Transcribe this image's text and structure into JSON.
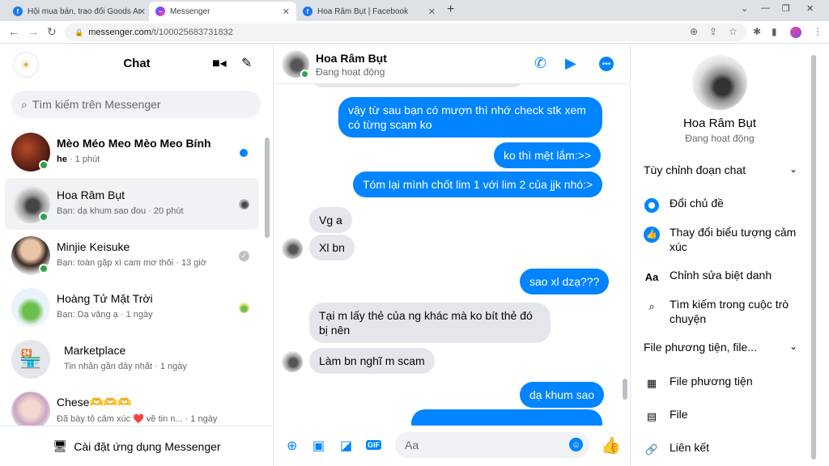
{
  "browser": {
    "tabs": [
      {
        "title": "Hội mua bán, trao đổi Goods An",
        "active": false
      },
      {
        "title": "Messenger",
        "active": true
      },
      {
        "title": "Hoa Râm Bụt | Facebook",
        "active": false
      }
    ],
    "url_domain": "messenger.com",
    "url_path": "/t/100025683731832"
  },
  "sidebar": {
    "title": "Chat",
    "search_placeholder": "Tìm kiếm trên Messenger",
    "conversations": [
      {
        "name": "Mèo Méo Meo Mèo Meo Bính",
        "preview_sender": "he",
        "preview_rest": " · 1 phút",
        "unread": true
      },
      {
        "name": "Hoa Râm Bụt",
        "preview": "Bạn: dạ khum sao đou · 20 phút",
        "selected": true
      },
      {
        "name": "Minjie Keisuke",
        "preview": "Bạn: toàn gặp xì cam mơ thôi · 13 giờ"
      },
      {
        "name": "Hoàng Tử Mặt Trời",
        "preview": "Bạn: Dạ vâng ạ · 1 ngày"
      },
      {
        "name": "Marketplace",
        "preview": "Tin nhắn gần đây nhất · 1 ngày"
      },
      {
        "name": "Chese🫶🫶🫶",
        "preview": "Đã bày tỏ cảm xúc ❤️ về tin n... · 1 ngày"
      }
    ],
    "install_label": "Cài đặt ứng dụng Messenger"
  },
  "chat": {
    "contact_name": "Hoa Râm Bụt",
    "contact_status": "Đang hoạt động",
    "messages": [
      {
        "text": "vậy từ sau bạn có mượn thì nhớ check stk xem có từng scam ko"
      },
      {
        "text": "ko thì mệt lắm:>>"
      },
      {
        "text": "Tóm lại mình chốt lim 1 với lim 2 của jjk nhó:>"
      },
      {
        "text": "Vg a"
      },
      {
        "text": "Xl bn"
      },
      {
        "text": "sao xl dzạ???"
      },
      {
        "text": "Tại m lấy thẻ của ng khác mà ko bít thẻ đó bị nên"
      },
      {
        "text": "Làm bn nghĩ m scam"
      },
      {
        "text": "dạ khum sao"
      }
    ],
    "composer_placeholder": "Aa"
  },
  "info": {
    "name": "Hoa Râm Bụt",
    "status": "Đang hoạt động",
    "section_customize": "Tùy chỉnh đoạn chat",
    "customize_items": [
      {
        "label": "Đổi chủ đề",
        "icon": "theme-icon"
      },
      {
        "label": "Thay đổi biểu tượng cảm xúc",
        "icon": "thumbs-up-icon"
      },
      {
        "label": "Chỉnh sửa biệt danh",
        "icon": "aa-icon"
      },
      {
        "label": "Tìm kiếm trong cuộc trò chuyện",
        "icon": "search-icon"
      }
    ],
    "section_media": "File phương tiện, file...",
    "media_items": [
      {
        "label": "File phương tiện",
        "icon": "media-icon"
      },
      {
        "label": "File",
        "icon": "file-icon"
      },
      {
        "label": "Liên kết",
        "icon": "link-icon"
      }
    ]
  },
  "colors": {
    "accent": "#0084ff",
    "online": "#31a24c"
  }
}
